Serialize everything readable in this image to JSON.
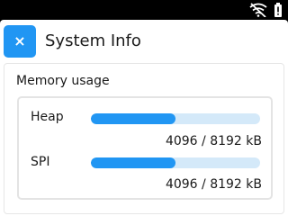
{
  "status_bar": {
    "icons": [
      "wifi-off-icon",
      "battery-alert-icon"
    ]
  },
  "header": {
    "close_icon": "×",
    "title": "System Info"
  },
  "section": {
    "label": "Memory usage"
  },
  "memory": [
    {
      "label": "Heap",
      "value": "4096 / 8192 kB",
      "fraction": 0.5
    },
    {
      "label": "SPI",
      "value": "4096 / 8192 kB",
      "fraction": 0.5
    }
  ],
  "colors": {
    "accent": "#2196F3",
    "track": "#d4e9f9",
    "background": "#ffffff",
    "status_bar": "#000000"
  }
}
